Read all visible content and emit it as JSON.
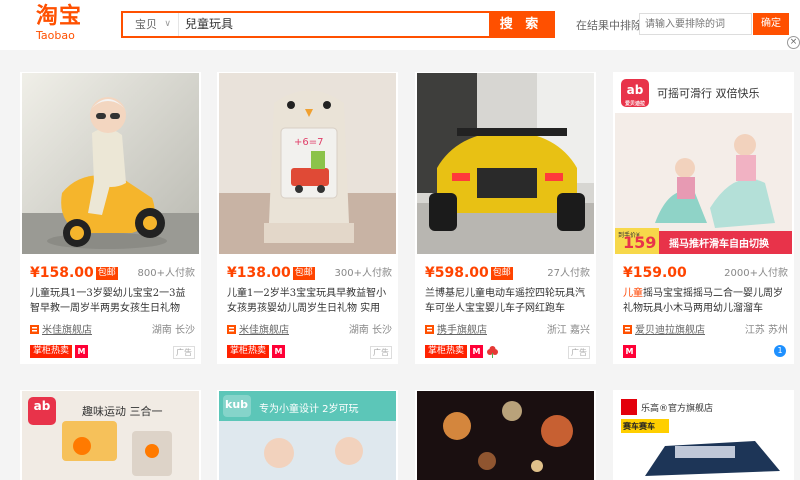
{
  "header": {
    "logo_cn": "淘宝",
    "logo_en": "Taobao",
    "search_scope": "宝贝",
    "search_query": "兒童玩具",
    "search_button": "搜 索",
    "exclude_label": "在结果中排除",
    "exclude_placeholder": "请输入要排除的词",
    "exclude_button": "确定",
    "close_symbol": "×"
  },
  "products": [
    {
      "price": "¥158.00",
      "post_tag": "包邮",
      "sales": "800+人付款",
      "title_hl": "",
      "title": "儿童玩具1一3岁婴幼儿宝宝2一3益智早教一周岁半两男女孩生日礼物",
      "shop": "米佳旗舰店",
      "location": "湖南 长沙",
      "hot": "掌柜热卖",
      "tmall": "M",
      "ad": "广告"
    },
    {
      "price": "¥138.00",
      "post_tag": "包邮",
      "sales": "300+人付款",
      "title_hl": "",
      "title": "儿童1一2岁半3宝宝玩具早教益智小女孩男孩婴幼儿周岁生日礼物 实用",
      "shop": "米佳旗舰店",
      "location": "湖南 长沙",
      "hot": "掌柜热卖",
      "tmall": "M",
      "ad": "广告"
    },
    {
      "price": "¥598.00",
      "post_tag": "包邮",
      "sales": "27人付款",
      "title_hl": "",
      "title": "兰博基尼儿童电动车遥控四轮玩具汽车可坐人宝宝婴儿车子网红跑车",
      "shop": "携手旗舰店",
      "location": "浙江 嘉兴",
      "hot": "掌柜热卖",
      "tmall": "M",
      "ad": "广告"
    },
    {
      "price": "¥159.00",
      "post_tag": "",
      "sales": "2000+人付款",
      "title_hl": "儿童",
      "title": "摇马宝宝摇摇马二合一婴儿周岁礼物玩具小木马两用幼儿溜溜车",
      "shop": "爱贝迪拉旗舰店",
      "location": "江苏 苏州",
      "hot": "",
      "tmall": "M",
      "ad": "1"
    }
  ],
  "promo": {
    "card4_brand": "ab",
    "card4_brand_sub": "爱贝迪拉",
    "card4_headline": "可摇可滑行 双倍快乐",
    "card4_price": "159",
    "card4_price_label": "到手价¥",
    "card4_banner": "摇马推杆滑车自由切换",
    "card5_brand": "ab",
    "card5_headline": "趣味运动 三合一",
    "card6_brand": "kub",
    "card6_headline": "专为小童设计 2岁可玩",
    "card8_store": "乐高®官方旗舰店",
    "card8_tag": "赛车赛车"
  },
  "colors": {
    "accent": "#ff5000",
    "price": "#ff4400",
    "tmall": "#ff0036"
  }
}
